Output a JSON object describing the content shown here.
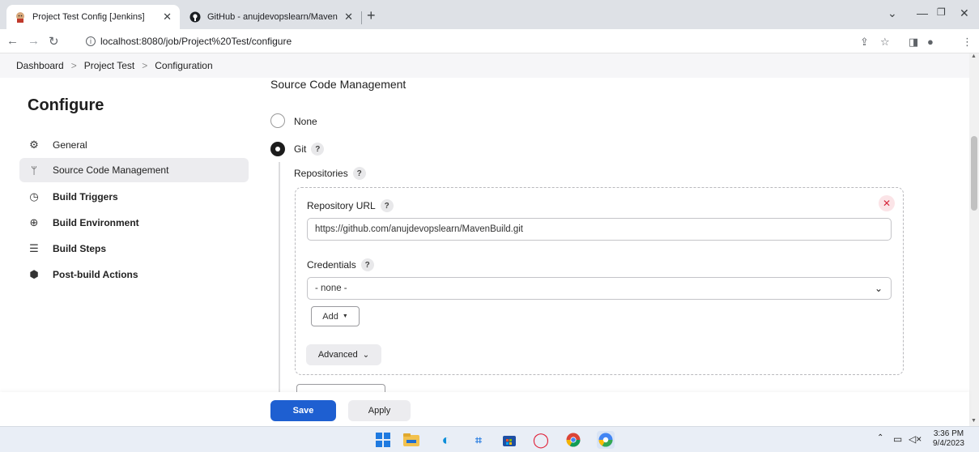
{
  "browser": {
    "tabs": [
      {
        "title": "Project Test Config [Jenkins]",
        "active": true
      },
      {
        "title": "GitHub - anujdevopslearn/Maven",
        "active": false
      }
    ],
    "url": "localhost:8080/job/Project%20Test/configure"
  },
  "breadcrumbs": [
    "Dashboard",
    "Project Test",
    "Configuration"
  ],
  "sidebar": {
    "title": "Configure",
    "items": [
      {
        "label": "General",
        "icon": "gear-icon"
      },
      {
        "label": "Source Code Management",
        "icon": "branch-icon",
        "selected": true
      },
      {
        "label": "Build Triggers",
        "icon": "clock-icon"
      },
      {
        "label": "Build Environment",
        "icon": "globe-icon"
      },
      {
        "label": "Build Steps",
        "icon": "list-icon"
      },
      {
        "label": "Post-build Actions",
        "icon": "box-icon"
      }
    ]
  },
  "scm": {
    "section_title": "Source Code Management",
    "option_none": "None",
    "option_git": "Git",
    "selected": "Git",
    "repositories_label": "Repositories",
    "repo_url_label": "Repository URL",
    "repo_url_value": "https://github.com/anujdevopslearn/MavenBuild.git",
    "credentials_label": "Credentials",
    "credentials_value": "- none -",
    "add_button": "Add",
    "advanced_button": "Advanced"
  },
  "footer": {
    "save": "Save",
    "apply": "Apply"
  },
  "taskbar": {
    "time": "3:36 PM",
    "date": "9/4/2023"
  },
  "colors": {
    "primary": "#1e5fd1",
    "danger": "#d6263b",
    "selected_bg": "#ececef"
  }
}
